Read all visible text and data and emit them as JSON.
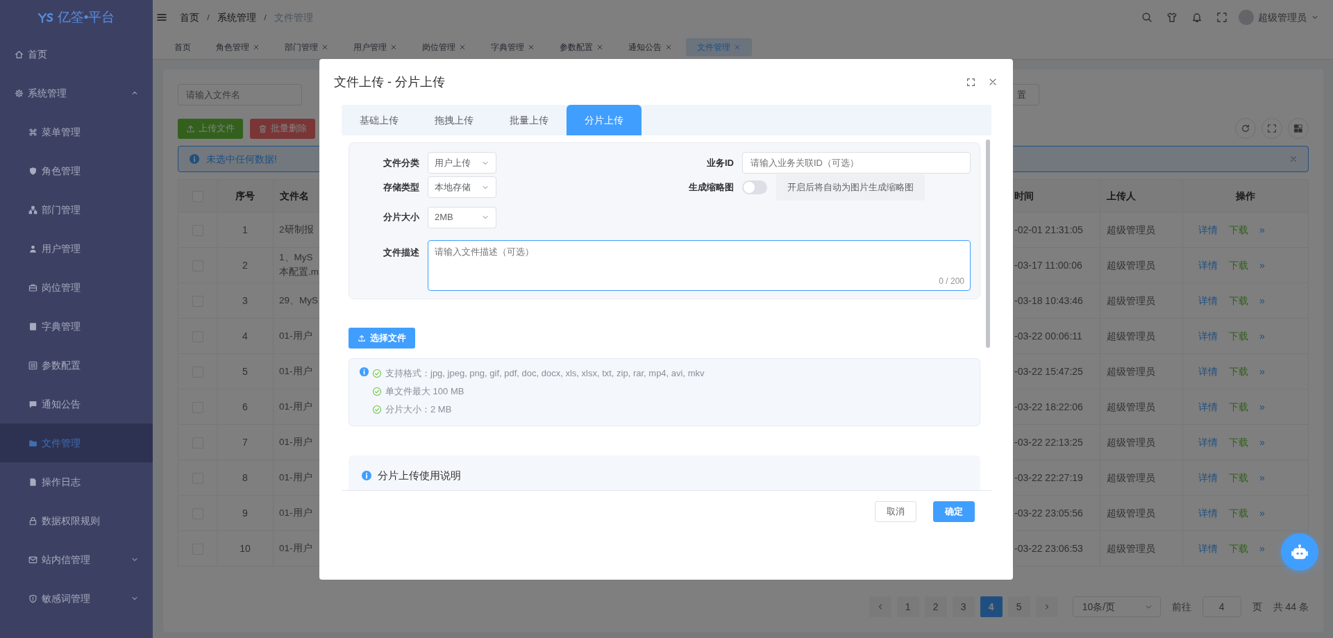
{
  "sidebar": {
    "logo": "亿筌•平台",
    "items": [
      {
        "label": "首页",
        "selected": false
      },
      {
        "label": "系统管理",
        "selected": false,
        "expanded": true,
        "children": [
          {
            "label": "菜单管理",
            "selected": false
          },
          {
            "label": "角色管理",
            "selected": false
          },
          {
            "label": "部门管理",
            "selected": false
          },
          {
            "label": "用户管理",
            "selected": false
          },
          {
            "label": "岗位管理",
            "selected": false
          },
          {
            "label": "字典管理",
            "selected": false
          },
          {
            "label": "参数配置",
            "selected": false
          },
          {
            "label": "通知公告",
            "selected": false
          },
          {
            "label": "文件管理",
            "selected": true
          },
          {
            "label": "操作日志",
            "selected": false
          },
          {
            "label": "数据权限规则",
            "selected": false
          },
          {
            "label": "站内信管理",
            "selected": false,
            "expanded": false
          },
          {
            "label": "敏感词管理",
            "selected": false,
            "expanded": false
          }
        ]
      }
    ]
  },
  "header": {
    "breadcrumb": [
      "首页",
      "系统管理",
      "文件管理"
    ],
    "user": "超级管理员"
  },
  "tabs": [
    {
      "label": "首页",
      "closable": false,
      "selected": false
    },
    {
      "label": "角色管理",
      "closable": true,
      "selected": false
    },
    {
      "label": "部门管理",
      "closable": true,
      "selected": false
    },
    {
      "label": "用户管理",
      "closable": true,
      "selected": false
    },
    {
      "label": "岗位管理",
      "closable": true,
      "selected": false
    },
    {
      "label": "字典管理",
      "closable": true,
      "selected": false
    },
    {
      "label": "参数配置",
      "closable": true,
      "selected": false
    },
    {
      "label": "通知公告",
      "closable": true,
      "selected": false
    },
    {
      "label": "文件管理",
      "closable": true,
      "selected": true
    }
  ],
  "toolbar": {
    "search": {
      "placeholder": "请输入文件名"
    },
    "reset_button": "置",
    "buttons": [
      {
        "label": "上传文件",
        "kind": "upload"
      },
      {
        "label": "批量删除",
        "kind": "delete"
      }
    ]
  },
  "alert": {
    "text": "未选中任何数据!"
  },
  "table": {
    "all_checked": false,
    "columns": [
      "序号",
      "文件名",
      "时间",
      "上传人",
      "操作"
    ],
    "rows": [
      {
        "checked": false,
        "index": "1",
        "file_name_lines": [
          "2研制报"
        ],
        "time": "-02-01 21:31:05",
        "uploader": "超级管理员",
        "actions": [
          {
            "label": "详情",
            "kind": "detail"
          },
          {
            "label": "下载",
            "kind": "download"
          },
          {
            "label": "»",
            "kind": "more"
          }
        ]
      },
      {
        "checked": false,
        "index": "2",
        "file_name_lines": [
          "1、MyS",
          "本配置.m"
        ],
        "time": "-03-17 11:00:06",
        "uploader": "超级管理员",
        "actions": [
          {
            "label": "详情",
            "kind": "detail"
          },
          {
            "label": "下载",
            "kind": "download"
          },
          {
            "label": "»",
            "kind": "more"
          }
        ]
      },
      {
        "checked": false,
        "index": "3",
        "file_name_lines": [
          "29、MyS"
        ],
        "time": "-03-18 10:43:46",
        "uploader": "超级管理员",
        "actions": [
          {
            "label": "详情",
            "kind": "detail"
          },
          {
            "label": "下载",
            "kind": "download"
          },
          {
            "label": "»",
            "kind": "more"
          }
        ]
      },
      {
        "checked": false,
        "index": "4",
        "file_name_lines": [
          "01-用户"
        ],
        "time": "-03-22 00:06:11",
        "uploader": "超级管理员",
        "actions": [
          {
            "label": "详情",
            "kind": "detail"
          },
          {
            "label": "下载",
            "kind": "download"
          },
          {
            "label": "»",
            "kind": "more"
          }
        ]
      },
      {
        "checked": false,
        "index": "5",
        "file_name_lines": [
          "01-用户"
        ],
        "time": "-03-22 15:47:25",
        "uploader": "超级管理员",
        "actions": [
          {
            "label": "详情",
            "kind": "detail"
          },
          {
            "label": "下载",
            "kind": "download"
          },
          {
            "label": "»",
            "kind": "more"
          }
        ]
      },
      {
        "checked": false,
        "index": "6",
        "file_name_lines": [
          "01-用户"
        ],
        "time": "-03-22 18:22:06",
        "uploader": "超级管理员",
        "actions": [
          {
            "label": "详情",
            "kind": "detail"
          },
          {
            "label": "下载",
            "kind": "download"
          },
          {
            "label": "»",
            "kind": "more"
          }
        ]
      },
      {
        "checked": false,
        "index": "7",
        "file_name_lines": [
          "01-用户"
        ],
        "time": "-03-22 22:13:25",
        "uploader": "超级管理员",
        "actions": [
          {
            "label": "详情",
            "kind": "detail"
          },
          {
            "label": "下载",
            "kind": "download"
          },
          {
            "label": "»",
            "kind": "more"
          }
        ]
      },
      {
        "checked": false,
        "index": "8",
        "file_name_lines": [
          "01-用户"
        ],
        "time": "-03-22 22:27:19",
        "uploader": "超级管理员",
        "actions": [
          {
            "label": "详情",
            "kind": "detail"
          },
          {
            "label": "下载",
            "kind": "download"
          },
          {
            "label": "»",
            "kind": "more"
          }
        ]
      },
      {
        "checked": false,
        "index": "9",
        "file_name_lines": [
          "01-用户"
        ],
        "time": "-03-22 23:05:56",
        "uploader": "超级管理员",
        "actions": [
          {
            "label": "详情",
            "kind": "detail"
          },
          {
            "label": "下载",
            "kind": "download"
          },
          {
            "label": "»",
            "kind": "more"
          }
        ]
      },
      {
        "checked": false,
        "index": "10",
        "file_name_lines": [
          "01-用户"
        ],
        "time": "-03-22 23:06:53",
        "uploader": "超级管理员",
        "actions": [
          {
            "label": "详情",
            "kind": "detail"
          },
          {
            "label": "下载",
            "kind": "download"
          },
          {
            "label": "»",
            "kind": "more"
          }
        ]
      }
    ]
  },
  "pagination": {
    "pages": [
      {
        "label": "1",
        "selected": false
      },
      {
        "label": "2",
        "selected": false
      },
      {
        "label": "3",
        "selected": false
      },
      {
        "label": "4",
        "selected": true
      },
      {
        "label": "5",
        "selected": false
      }
    ],
    "page_size": "10条/页",
    "goto_label": "前往",
    "goto_value": "4",
    "page_unit": "页",
    "total": "共 44 条"
  },
  "modal": {
    "title": "文件上传 - 分片上传",
    "tabs": [
      {
        "label": "基础上传",
        "selected": false
      },
      {
        "label": "拖拽上传",
        "selected": false
      },
      {
        "label": "批量上传",
        "selected": false
      },
      {
        "label": "分片上传",
        "selected": true
      }
    ],
    "form": {
      "selects": [
        {
          "label": "文件分类",
          "value": "用户上传"
        },
        {
          "label": "存储类型",
          "value": "本地存储"
        },
        {
          "label": "分片大小",
          "value": "2MB"
        }
      ],
      "business_id": {
        "label": "业务ID",
        "placeholder": "请输入业务关联ID（可选）"
      },
      "thumbnail": {
        "label": "生成缩略图",
        "on": false,
        "hint": "开启后将自动为图片生成缩略图"
      },
      "description": {
        "label": "文件描述",
        "placeholder": "请输入文件描述（可选）",
        "counter": "0 / 200",
        "focused": true
      }
    },
    "select_button": "选择文件",
    "tips": [
      "支持格式：jpg, jpeg, png, gif, pdf, doc, docx, xls, xlsx, txt, zip, rar, mp4, avi, mkv",
      "单文件最大 100 MB",
      "分片大小：2 MB"
    ],
    "usage_title": "分片上传使用说明",
    "buttons": [
      {
        "label": "取消",
        "kind": "secondary"
      },
      {
        "label": "确定",
        "kind": "primary"
      }
    ]
  }
}
